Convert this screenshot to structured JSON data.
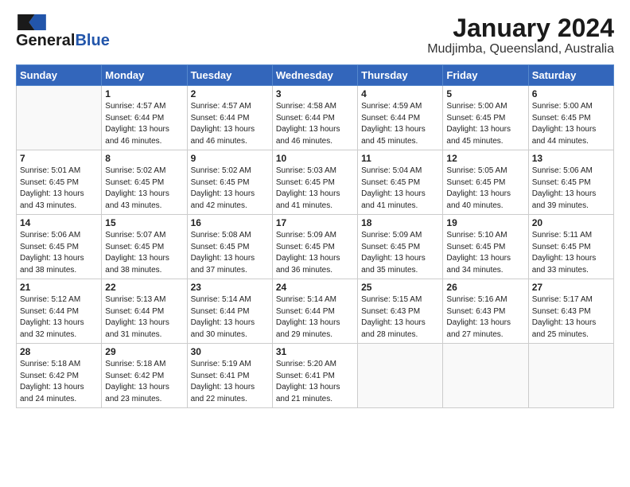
{
  "logo": {
    "line1": "General",
    "line2": "Blue"
  },
  "title": "January 2024",
  "subtitle": "Mudjimba, Queensland, Australia",
  "headers": [
    "Sunday",
    "Monday",
    "Tuesday",
    "Wednesday",
    "Thursday",
    "Friday",
    "Saturday"
  ],
  "weeks": [
    [
      {
        "day": "",
        "sunrise": "",
        "sunset": "",
        "daylight": ""
      },
      {
        "day": "1",
        "sunrise": "Sunrise: 4:57 AM",
        "sunset": "Sunset: 6:44 PM",
        "daylight": "Daylight: 13 hours and 46 minutes."
      },
      {
        "day": "2",
        "sunrise": "Sunrise: 4:57 AM",
        "sunset": "Sunset: 6:44 PM",
        "daylight": "Daylight: 13 hours and 46 minutes."
      },
      {
        "day": "3",
        "sunrise": "Sunrise: 4:58 AM",
        "sunset": "Sunset: 6:44 PM",
        "daylight": "Daylight: 13 hours and 46 minutes."
      },
      {
        "day": "4",
        "sunrise": "Sunrise: 4:59 AM",
        "sunset": "Sunset: 6:44 PM",
        "daylight": "Daylight: 13 hours and 45 minutes."
      },
      {
        "day": "5",
        "sunrise": "Sunrise: 5:00 AM",
        "sunset": "Sunset: 6:45 PM",
        "daylight": "Daylight: 13 hours and 45 minutes."
      },
      {
        "day": "6",
        "sunrise": "Sunrise: 5:00 AM",
        "sunset": "Sunset: 6:45 PM",
        "daylight": "Daylight: 13 hours and 44 minutes."
      }
    ],
    [
      {
        "day": "7",
        "sunrise": "Sunrise: 5:01 AM",
        "sunset": "Sunset: 6:45 PM",
        "daylight": "Daylight: 13 hours and 43 minutes."
      },
      {
        "day": "8",
        "sunrise": "Sunrise: 5:02 AM",
        "sunset": "Sunset: 6:45 PM",
        "daylight": "Daylight: 13 hours and 43 minutes."
      },
      {
        "day": "9",
        "sunrise": "Sunrise: 5:02 AM",
        "sunset": "Sunset: 6:45 PM",
        "daylight": "Daylight: 13 hours and 42 minutes."
      },
      {
        "day": "10",
        "sunrise": "Sunrise: 5:03 AM",
        "sunset": "Sunset: 6:45 PM",
        "daylight": "Daylight: 13 hours and 41 minutes."
      },
      {
        "day": "11",
        "sunrise": "Sunrise: 5:04 AM",
        "sunset": "Sunset: 6:45 PM",
        "daylight": "Daylight: 13 hours and 41 minutes."
      },
      {
        "day": "12",
        "sunrise": "Sunrise: 5:05 AM",
        "sunset": "Sunset: 6:45 PM",
        "daylight": "Daylight: 13 hours and 40 minutes."
      },
      {
        "day": "13",
        "sunrise": "Sunrise: 5:06 AM",
        "sunset": "Sunset: 6:45 PM",
        "daylight": "Daylight: 13 hours and 39 minutes."
      }
    ],
    [
      {
        "day": "14",
        "sunrise": "Sunrise: 5:06 AM",
        "sunset": "Sunset: 6:45 PM",
        "daylight": "Daylight: 13 hours and 38 minutes."
      },
      {
        "day": "15",
        "sunrise": "Sunrise: 5:07 AM",
        "sunset": "Sunset: 6:45 PM",
        "daylight": "Daylight: 13 hours and 38 minutes."
      },
      {
        "day": "16",
        "sunrise": "Sunrise: 5:08 AM",
        "sunset": "Sunset: 6:45 PM",
        "daylight": "Daylight: 13 hours and 37 minutes."
      },
      {
        "day": "17",
        "sunrise": "Sunrise: 5:09 AM",
        "sunset": "Sunset: 6:45 PM",
        "daylight": "Daylight: 13 hours and 36 minutes."
      },
      {
        "day": "18",
        "sunrise": "Sunrise: 5:09 AM",
        "sunset": "Sunset: 6:45 PM",
        "daylight": "Daylight: 13 hours and 35 minutes."
      },
      {
        "day": "19",
        "sunrise": "Sunrise: 5:10 AM",
        "sunset": "Sunset: 6:45 PM",
        "daylight": "Daylight: 13 hours and 34 minutes."
      },
      {
        "day": "20",
        "sunrise": "Sunrise: 5:11 AM",
        "sunset": "Sunset: 6:45 PM",
        "daylight": "Daylight: 13 hours and 33 minutes."
      }
    ],
    [
      {
        "day": "21",
        "sunrise": "Sunrise: 5:12 AM",
        "sunset": "Sunset: 6:44 PM",
        "daylight": "Daylight: 13 hours and 32 minutes."
      },
      {
        "day": "22",
        "sunrise": "Sunrise: 5:13 AM",
        "sunset": "Sunset: 6:44 PM",
        "daylight": "Daylight: 13 hours and 31 minutes."
      },
      {
        "day": "23",
        "sunrise": "Sunrise: 5:14 AM",
        "sunset": "Sunset: 6:44 PM",
        "daylight": "Daylight: 13 hours and 30 minutes."
      },
      {
        "day": "24",
        "sunrise": "Sunrise: 5:14 AM",
        "sunset": "Sunset: 6:44 PM",
        "daylight": "Daylight: 13 hours and 29 minutes."
      },
      {
        "day": "25",
        "sunrise": "Sunrise: 5:15 AM",
        "sunset": "Sunset: 6:43 PM",
        "daylight": "Daylight: 13 hours and 28 minutes."
      },
      {
        "day": "26",
        "sunrise": "Sunrise: 5:16 AM",
        "sunset": "Sunset: 6:43 PM",
        "daylight": "Daylight: 13 hours and 27 minutes."
      },
      {
        "day": "27",
        "sunrise": "Sunrise: 5:17 AM",
        "sunset": "Sunset: 6:43 PM",
        "daylight": "Daylight: 13 hours and 25 minutes."
      }
    ],
    [
      {
        "day": "28",
        "sunrise": "Sunrise: 5:18 AM",
        "sunset": "Sunset: 6:42 PM",
        "daylight": "Daylight: 13 hours and 24 minutes."
      },
      {
        "day": "29",
        "sunrise": "Sunrise: 5:18 AM",
        "sunset": "Sunset: 6:42 PM",
        "daylight": "Daylight: 13 hours and 23 minutes."
      },
      {
        "day": "30",
        "sunrise": "Sunrise: 5:19 AM",
        "sunset": "Sunset: 6:41 PM",
        "daylight": "Daylight: 13 hours and 22 minutes."
      },
      {
        "day": "31",
        "sunrise": "Sunrise: 5:20 AM",
        "sunset": "Sunset: 6:41 PM",
        "daylight": "Daylight: 13 hours and 21 minutes."
      },
      {
        "day": "",
        "sunrise": "",
        "sunset": "",
        "daylight": ""
      },
      {
        "day": "",
        "sunrise": "",
        "sunset": "",
        "daylight": ""
      },
      {
        "day": "",
        "sunrise": "",
        "sunset": "",
        "daylight": ""
      }
    ]
  ]
}
